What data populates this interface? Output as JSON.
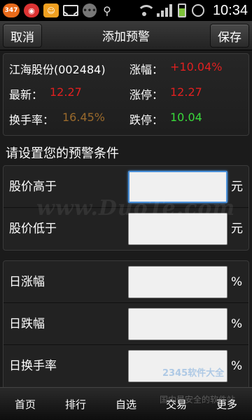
{
  "status_bar": {
    "notification_count": "347",
    "time": "10:34",
    "icons": [
      "notification-badge-icon",
      "weibo-icon",
      "qq-icon",
      "mail-icon",
      "dots-icon",
      "usb-icon",
      "wifi-icon",
      "signal-icon",
      "battery-icon",
      "alarm-icon"
    ]
  },
  "header": {
    "cancel_label": "取消",
    "title": "添加预警",
    "save_label": "保存"
  },
  "stock": {
    "name_code": "江海股份(002484)",
    "change_pct_label": "涨幅：",
    "change_pct_value": "+10.04%",
    "latest_label": "最新：",
    "latest_value": "12.27",
    "limit_up_label": "涨停：",
    "limit_up_value": "12.27",
    "turnover_label": "换手率：",
    "turnover_value": "16.45%",
    "limit_down_label": "跌停：",
    "limit_down_value": "10.04",
    "colors": {
      "up": "#e02020",
      "turnover": "#9a6a2c",
      "down": "#39d93a"
    }
  },
  "conditions": {
    "section_title": "请设置您的预警条件",
    "price_group": [
      {
        "label": "股价高于",
        "value": "",
        "unit": "元"
      },
      {
        "label": "股价低于",
        "value": "",
        "unit": "元"
      }
    ],
    "pct_group": [
      {
        "label": "日涨幅",
        "value": "",
        "unit": "%"
      },
      {
        "label": "日跌幅",
        "value": "",
        "unit": "%"
      },
      {
        "label": "日换手率",
        "value": "",
        "unit": "%"
      }
    ]
  },
  "tabbar": {
    "tabs": [
      "首页",
      "排行",
      "自选",
      "交易",
      "更多"
    ]
  },
  "watermarks": {
    "center": "www.DuoTe.com",
    "logo": "2345软件大全",
    "slogan": "国内最安全的软件站"
  }
}
